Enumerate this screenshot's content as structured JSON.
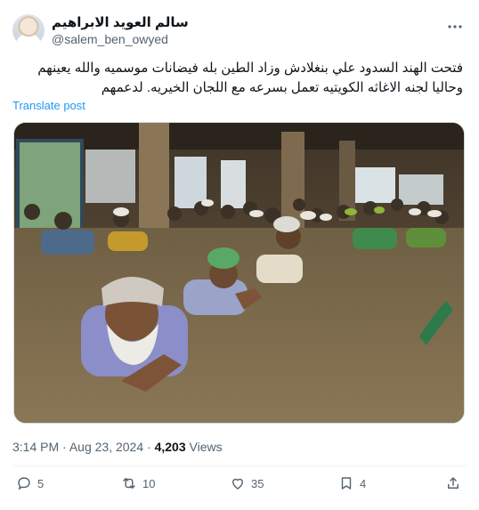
{
  "author": {
    "display_name": "سالم العويد الابراهيم",
    "handle": "@salem_ben_owyed"
  },
  "menu_icon": "more-horizontal-icon",
  "tweet": {
    "text_line1": "فتحت الهند السدود علي بنغلادش وزاد الطين بله فيضانات موسميه والله يعينهم",
    "text_line2": "وحاليا لجنه الاغاثه الكويتيه تعمل بسرعه مع اللجان الخيريه. لدعمهم",
    "translate_label": "Translate post"
  },
  "meta": {
    "time": "3:14 PM",
    "separator": "·",
    "date": "Aug 23, 2024",
    "views_count": "4,203",
    "views_label": "Views"
  },
  "actions": {
    "replies": "5",
    "reposts": "10",
    "likes": "35",
    "bookmarks": "4"
  },
  "colors": {
    "link": "#1d9bf0",
    "secondary_text": "#536471",
    "primary_text": "#0f1419"
  }
}
